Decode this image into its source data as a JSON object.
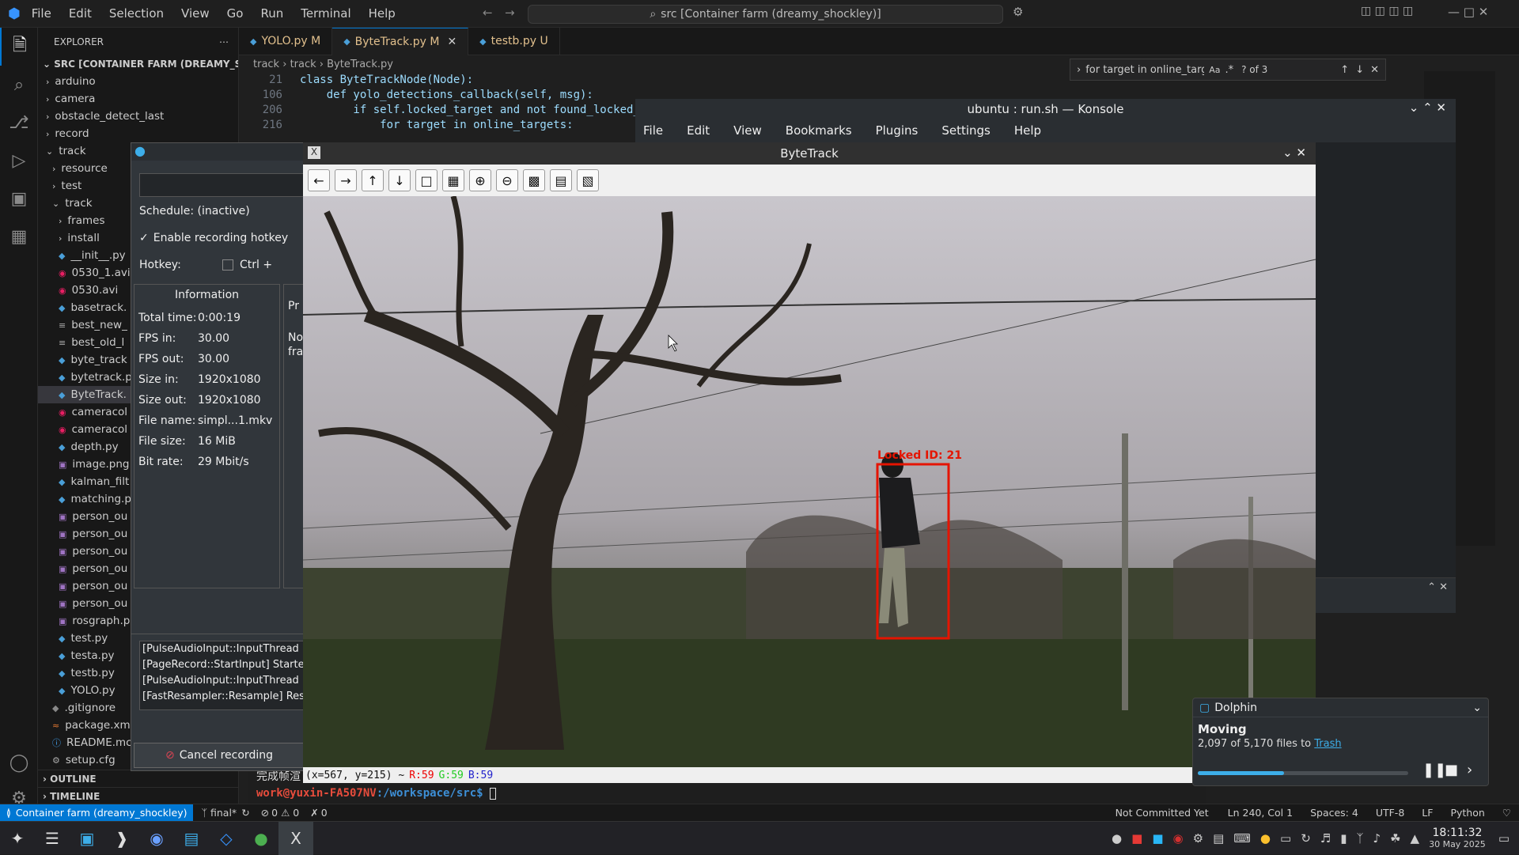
{
  "vscode": {
    "menu": [
      "File",
      "Edit",
      "Selection",
      "View",
      "Go",
      "Run",
      "Terminal",
      "Help"
    ],
    "command_center": "src [Container farm (dreamy_shockley)]",
    "explorer_title": "EXPLORER",
    "root": "SRC [CONTAINER FARM (DREAMY_SHOCK...",
    "tree": [
      {
        "label": "arduino",
        "indent": 0,
        "type": "folder"
      },
      {
        "label": "camera",
        "indent": 0,
        "type": "folder"
      },
      {
        "label": "obstacle_detect_last",
        "indent": 0,
        "type": "folder"
      },
      {
        "label": "record",
        "indent": 0,
        "type": "folder"
      },
      {
        "label": "track",
        "indent": 0,
        "type": "folder-open"
      },
      {
        "label": "resource",
        "indent": 1,
        "type": "folder"
      },
      {
        "label": "test",
        "indent": 1,
        "type": "folder"
      },
      {
        "label": "track",
        "indent": 1,
        "type": "folder-open"
      },
      {
        "label": "frames",
        "indent": 2,
        "type": "folder"
      },
      {
        "label": "install",
        "indent": 2,
        "type": "folder"
      },
      {
        "label": "__init__.py",
        "indent": 2,
        "type": "py"
      },
      {
        "label": "0530_1.avi",
        "indent": 2,
        "type": "media"
      },
      {
        "label": "0530.avi",
        "indent": 2,
        "type": "media"
      },
      {
        "label": "basetrack.",
        "indent": 2,
        "type": "py"
      },
      {
        "label": "best_new_",
        "indent": 2,
        "type": "txt"
      },
      {
        "label": "best_old_l",
        "indent": 2,
        "type": "txt"
      },
      {
        "label": "byte_track",
        "indent": 2,
        "type": "py"
      },
      {
        "label": "bytetrack.p",
        "indent": 2,
        "type": "py"
      },
      {
        "label": "ByteTrack.",
        "indent": 2,
        "type": "py",
        "selected": true
      },
      {
        "label": "cameracol",
        "indent": 2,
        "type": "media"
      },
      {
        "label": "cameracol",
        "indent": 2,
        "type": "media"
      },
      {
        "label": "depth.py",
        "indent": 2,
        "type": "py"
      },
      {
        "label": "image.png",
        "indent": 2,
        "type": "img"
      },
      {
        "label": "kalman_filt",
        "indent": 2,
        "type": "py"
      },
      {
        "label": "matching.p",
        "indent": 2,
        "type": "py"
      },
      {
        "label": "person_ou",
        "indent": 2,
        "type": "img"
      },
      {
        "label": "person_ou",
        "indent": 2,
        "type": "img"
      },
      {
        "label": "person_ou",
        "indent": 2,
        "type": "img"
      },
      {
        "label": "person_ou",
        "indent": 2,
        "type": "img"
      },
      {
        "label": "person_ou",
        "indent": 2,
        "type": "img"
      },
      {
        "label": "person_ou",
        "indent": 2,
        "type": "img"
      },
      {
        "label": "rosgraph.p",
        "indent": 2,
        "type": "img"
      },
      {
        "label": "test.py",
        "indent": 2,
        "type": "py"
      },
      {
        "label": "testa.py",
        "indent": 2,
        "type": "py"
      },
      {
        "label": "testb.py",
        "indent": 2,
        "type": "py"
      },
      {
        "label": "YOLO.py",
        "indent": 2,
        "type": "py"
      },
      {
        "label": ".gitignore",
        "indent": 1,
        "type": "git"
      },
      {
        "label": "package.xm",
        "indent": 1,
        "type": "xml"
      },
      {
        "label": "README.mc",
        "indent": 1,
        "type": "md"
      },
      {
        "label": "setup.cfg",
        "indent": 1,
        "type": "cfg"
      }
    ],
    "outline": "OUTLINE",
    "timeline": "TIMELINE",
    "tabs": [
      {
        "label": "YOLO.py M"
      },
      {
        "label": "ByteTrack.py M",
        "active": true
      },
      {
        "label": "testb.py U"
      }
    ],
    "breadcrumb": [
      "track",
      "track",
      "ByteTrack.py"
    ],
    "code": [
      {
        "ln": "21",
        "text": "class ByteTrackNode(Node):"
      },
      {
        "ln": "106",
        "text": "    def yolo_detections_callback(self, msg):"
      },
      {
        "ln": "206",
        "text": "        if self.locked_target and not found_locked_"
      },
      {
        "ln": "216",
        "text": "            for target in online_targets:"
      }
    ],
    "find": {
      "query": "for target in online_targ",
      "count": "? of 3"
    },
    "status": {
      "remote": "Container farm (dreamy_shockley)",
      "branch": "final*",
      "problems": "0 ⚠ 0",
      "ports": "0",
      "commit": "Not Committed Yet",
      "position": "Ln 240, Col 1",
      "spaces": "Spaces: 4",
      "encoding": "UTF-8",
      "eol": "LF",
      "lang": "Python"
    }
  },
  "konsole": {
    "title": "ubuntu : run.sh — Konsole",
    "menu": [
      "File",
      "Edit",
      "View",
      "Bookmarks",
      "Plugins",
      "Settings",
      "Help"
    ],
    "line_cn": "完成帧渲",
    "prompt_user": "work@yuxin-FA507NV",
    "prompt_path": ":/workspace/src$"
  },
  "recorder": {
    "schedule": "Schedule: (inactive)",
    "hotkey_enable": "Enable recording hotkey",
    "hotkey_label": "Hotkey:",
    "hotkey_mod": "Ctrl +",
    "info_title": "Information",
    "info": [
      [
        "Total time:",
        "0:00:19"
      ],
      [
        "FPS in:",
        "30.00"
      ],
      [
        "FPS out:",
        "30.00"
      ],
      [
        "Size in:",
        "1920x1080"
      ],
      [
        "Size out:",
        "1920x1080"
      ],
      [
        "File name:",
        "simpl...1.mkv"
      ],
      [
        "File size:",
        "16 MiB"
      ],
      [
        "Bit rate:",
        "29 Mbit/s"
      ]
    ],
    "side_text": [
      "Pr",
      "No",
      "fra"
    ],
    "log": [
      "[PulseAudioInput::InputThread",
      "[PageRecord::StartInput] Starte",
      "[PulseAudioInput::InputThread",
      "[FastResampler::Resample] Res"
    ],
    "cancel": "Cancel recording"
  },
  "bytetrack": {
    "title": "ByteTrack",
    "label": "Locked ID: 21",
    "status_coord": "(x=567, y=215) ~",
    "r": "R:59",
    "g": "G:59",
    "b": "B:59"
  },
  "dolphin": {
    "app": "Dolphin",
    "heading": "Moving",
    "text": "2,097 of 5,170 files to",
    "link": "Trash",
    "progress": 0.41
  },
  "clock": {
    "time": "18:11:32",
    "date": "30 May 2025"
  },
  "colors": {
    "accent": "#0078d4",
    "red": "#e51400"
  }
}
